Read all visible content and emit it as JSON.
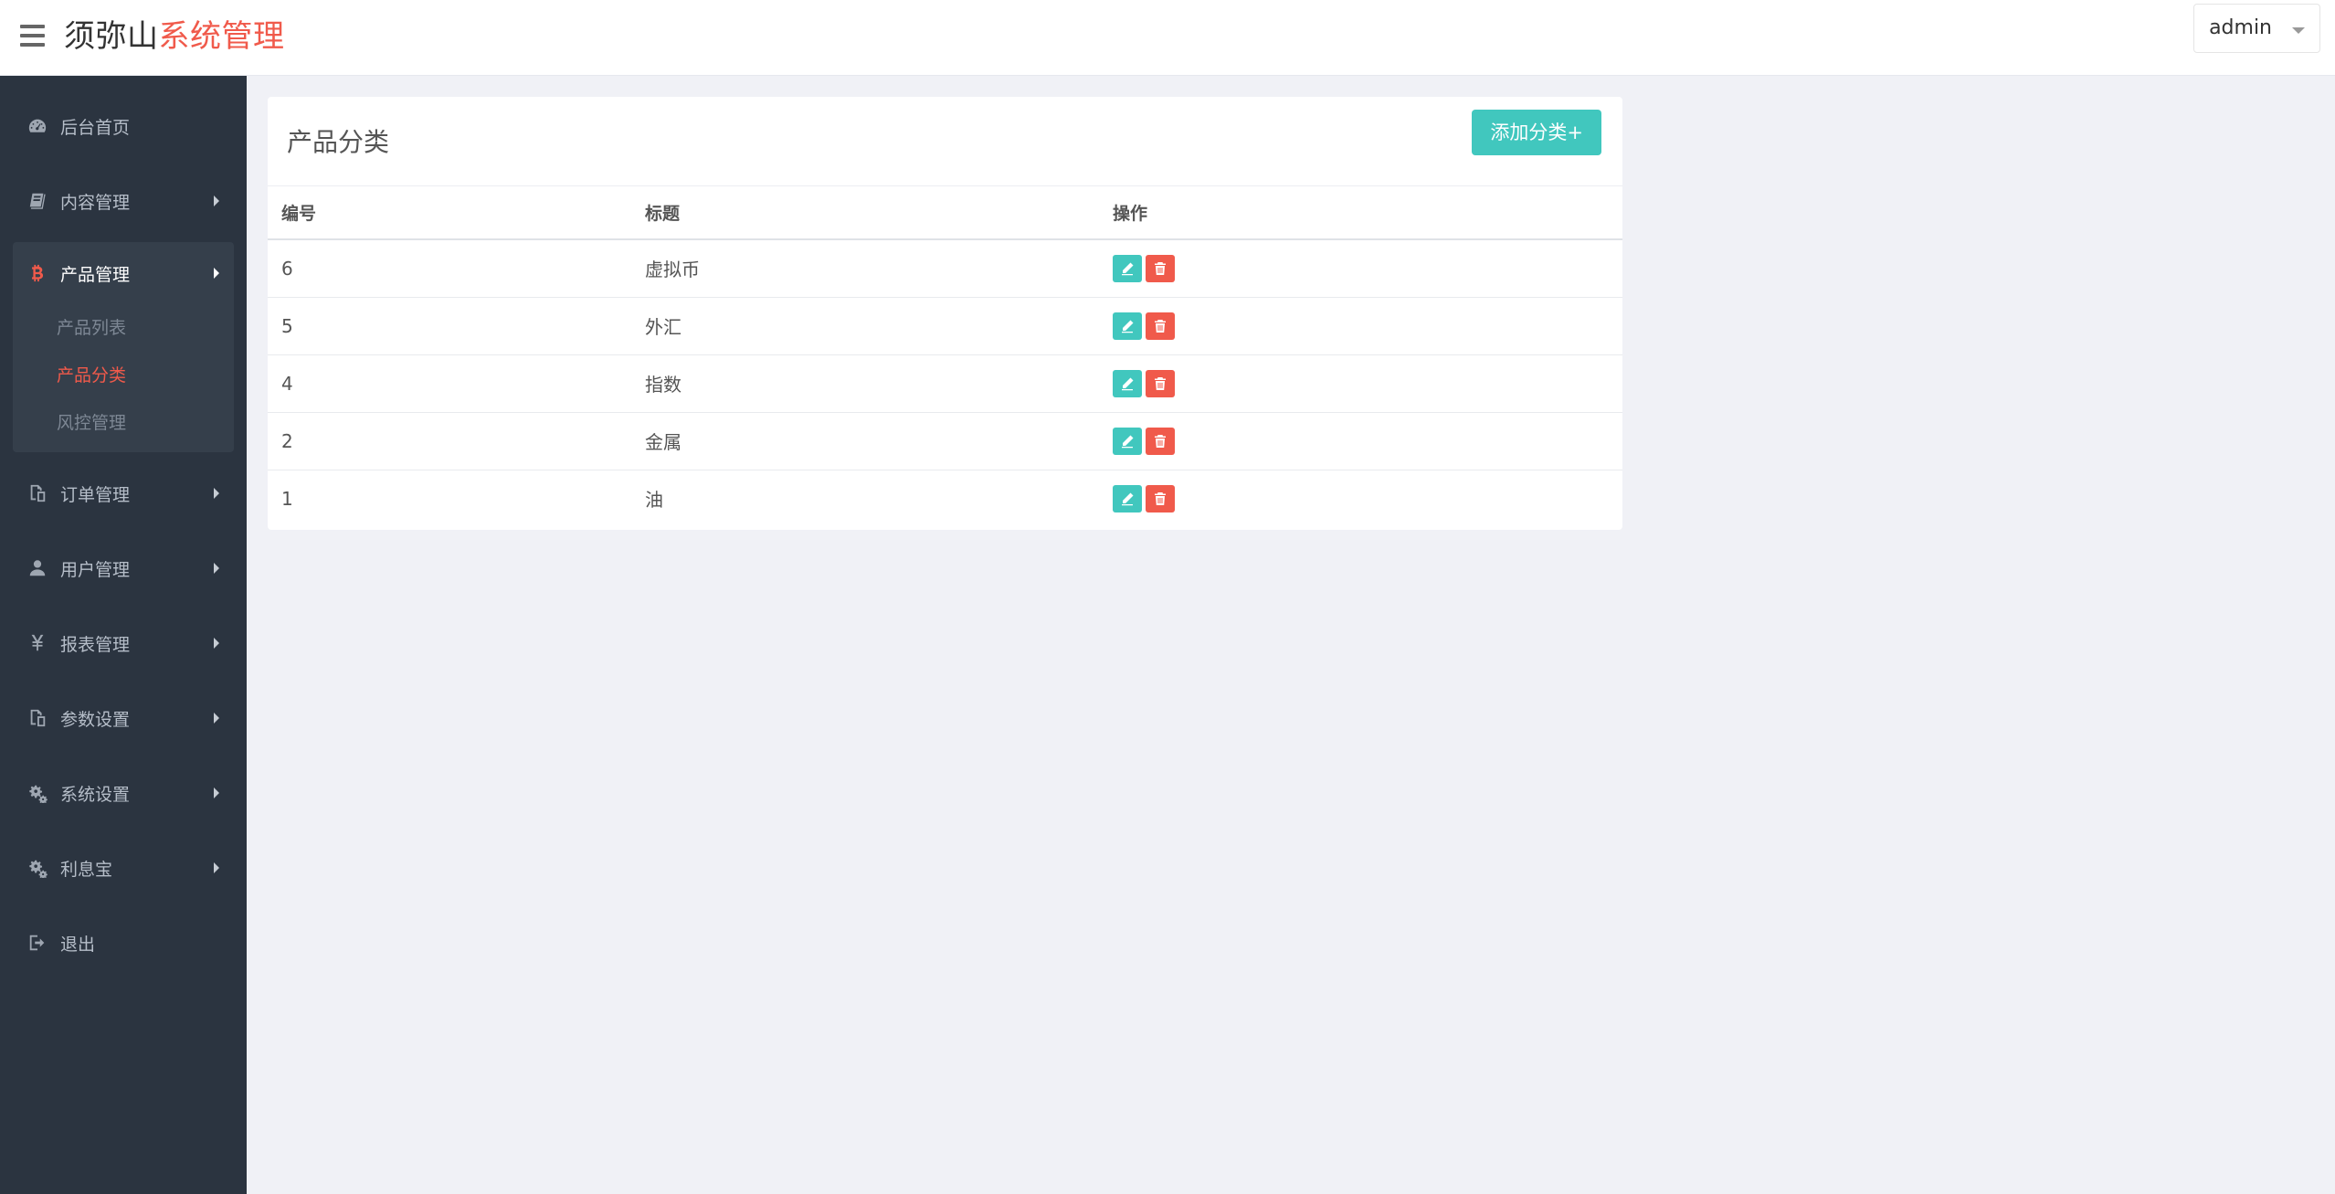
{
  "header": {
    "brand_main": "须弥山",
    "brand_accent": "系统管理",
    "user": "admin"
  },
  "sidebar": {
    "items": [
      {
        "label": "后台首页",
        "icon": "dashboard-icon"
      },
      {
        "label": "内容管理",
        "icon": "book-icon"
      },
      {
        "label": "产品管理",
        "icon": "bitcoin-icon"
      },
      {
        "label": "订单管理",
        "icon": "copy-icon"
      },
      {
        "label": "用户管理",
        "icon": "user-icon"
      },
      {
        "label": "报表管理",
        "icon": "yen-icon"
      },
      {
        "label": "参数设置",
        "icon": "copy-icon"
      },
      {
        "label": "系统设置",
        "icon": "gears-icon"
      },
      {
        "label": "利息宝",
        "icon": "gears-icon"
      },
      {
        "label": "退出",
        "icon": "sign-out-icon"
      }
    ],
    "product_submenu": [
      "产品列表",
      "产品分类",
      "风控管理"
    ],
    "active_submenu": "产品分类",
    "accent_color": "#f05a4b"
  },
  "panel": {
    "title": "产品分类",
    "add_button": "添加分类+"
  },
  "table": {
    "columns": [
      "编号",
      "标题",
      "操作"
    ],
    "rows": [
      {
        "id": "6",
        "title": "虚拟币"
      },
      {
        "id": "5",
        "title": "外汇"
      },
      {
        "id": "4",
        "title": "指数"
      },
      {
        "id": "2",
        "title": "金属"
      },
      {
        "id": "1",
        "title": "油"
      }
    ]
  },
  "colors": {
    "edit": "#41c7be",
    "delete": "#f05a4b",
    "sidebar_bg": "#2b3440"
  }
}
